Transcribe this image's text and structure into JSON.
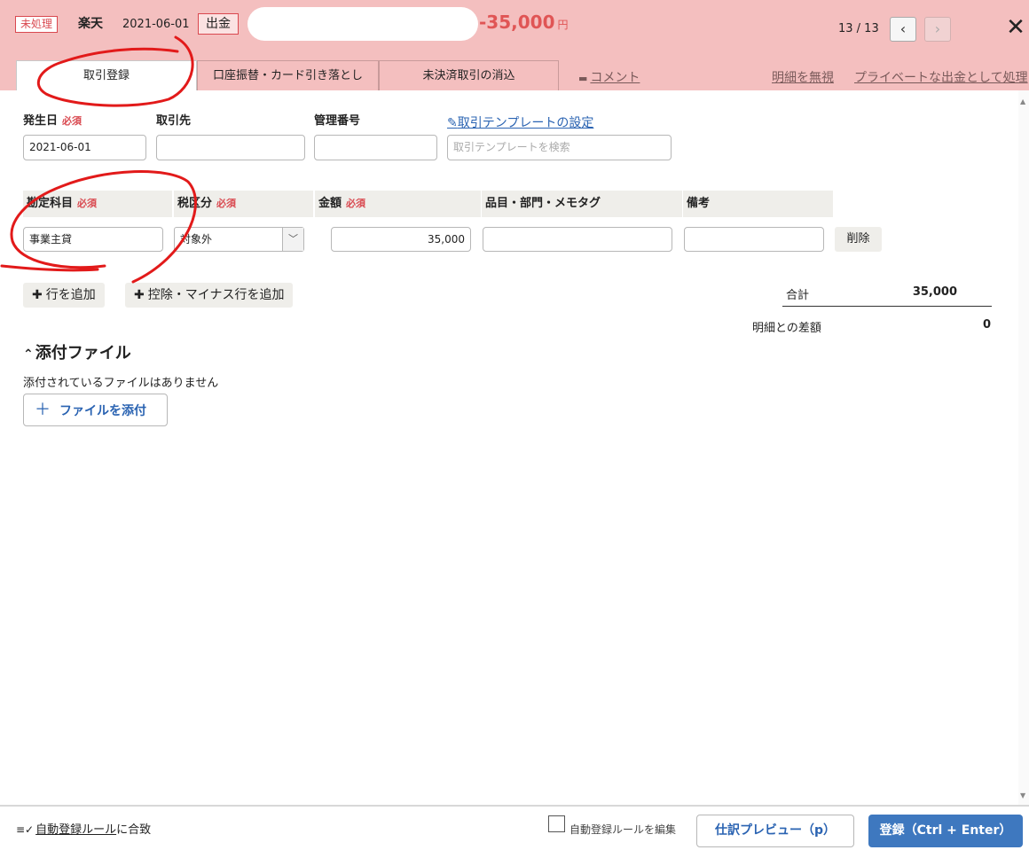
{
  "header": {
    "status_badge": "未処理",
    "bank": "楽天",
    "date": "2021-06-01",
    "type_badge": "出金",
    "amount": "-35,000",
    "currency": "円",
    "pager": "13 / 13",
    "prev": "‹",
    "next": "›",
    "close": "✕"
  },
  "tabs": [
    {
      "label": "取引登録",
      "active": true
    },
    {
      "label": "口座振替・カード引き落とし",
      "active": false
    },
    {
      "label": "未決済取引の消込",
      "active": false
    }
  ],
  "links": {
    "comment": "コメント",
    "ignore": "明細を無視",
    "private": "プライベートな出金として処理",
    "template_settings": "取引テンプレートの設定"
  },
  "form": {
    "required": "必須",
    "date_label": "発生日",
    "date_value": "2021-06-01",
    "partner_label": "取引先",
    "partner_value": "",
    "mgmt_label": "管理番号",
    "mgmt_value": "",
    "template_placeholder": "取引テンプレートを検索"
  },
  "table": {
    "headers": {
      "account": "勘定科目",
      "tax": "税区分",
      "amount": "金額",
      "tags": "品目・部門・メモタグ",
      "note": "備考"
    },
    "rows": [
      {
        "account": "事業主貸",
        "tax": "対象外",
        "amount": "35,000",
        "tags": "",
        "note": "",
        "delete": "削除"
      }
    ]
  },
  "actions": {
    "add_row": "行を追加",
    "add_minus_row": "控除・マイナス行を追加"
  },
  "totals": {
    "sum_label": "合計",
    "sum_value": "35,000",
    "diff_label": "明細との差額",
    "diff_value": "0"
  },
  "attachments": {
    "title": "添付ファイル",
    "empty": "添付されているファイルはありません",
    "add": "ファイルを添付"
  },
  "footer": {
    "rule_link": "自動登録ルール",
    "rule_suffix": "に合致",
    "edit_rule": "自動登録ルールを編集",
    "preview": "仕訳プレビュー（p）",
    "submit": "登録（Ctrl + Enter）"
  },
  "colors": {
    "header_bg": "#f4bfbf",
    "accent_red": "#d9484f",
    "link_blue": "#2a63b2",
    "primary_button": "#3e78bf"
  }
}
